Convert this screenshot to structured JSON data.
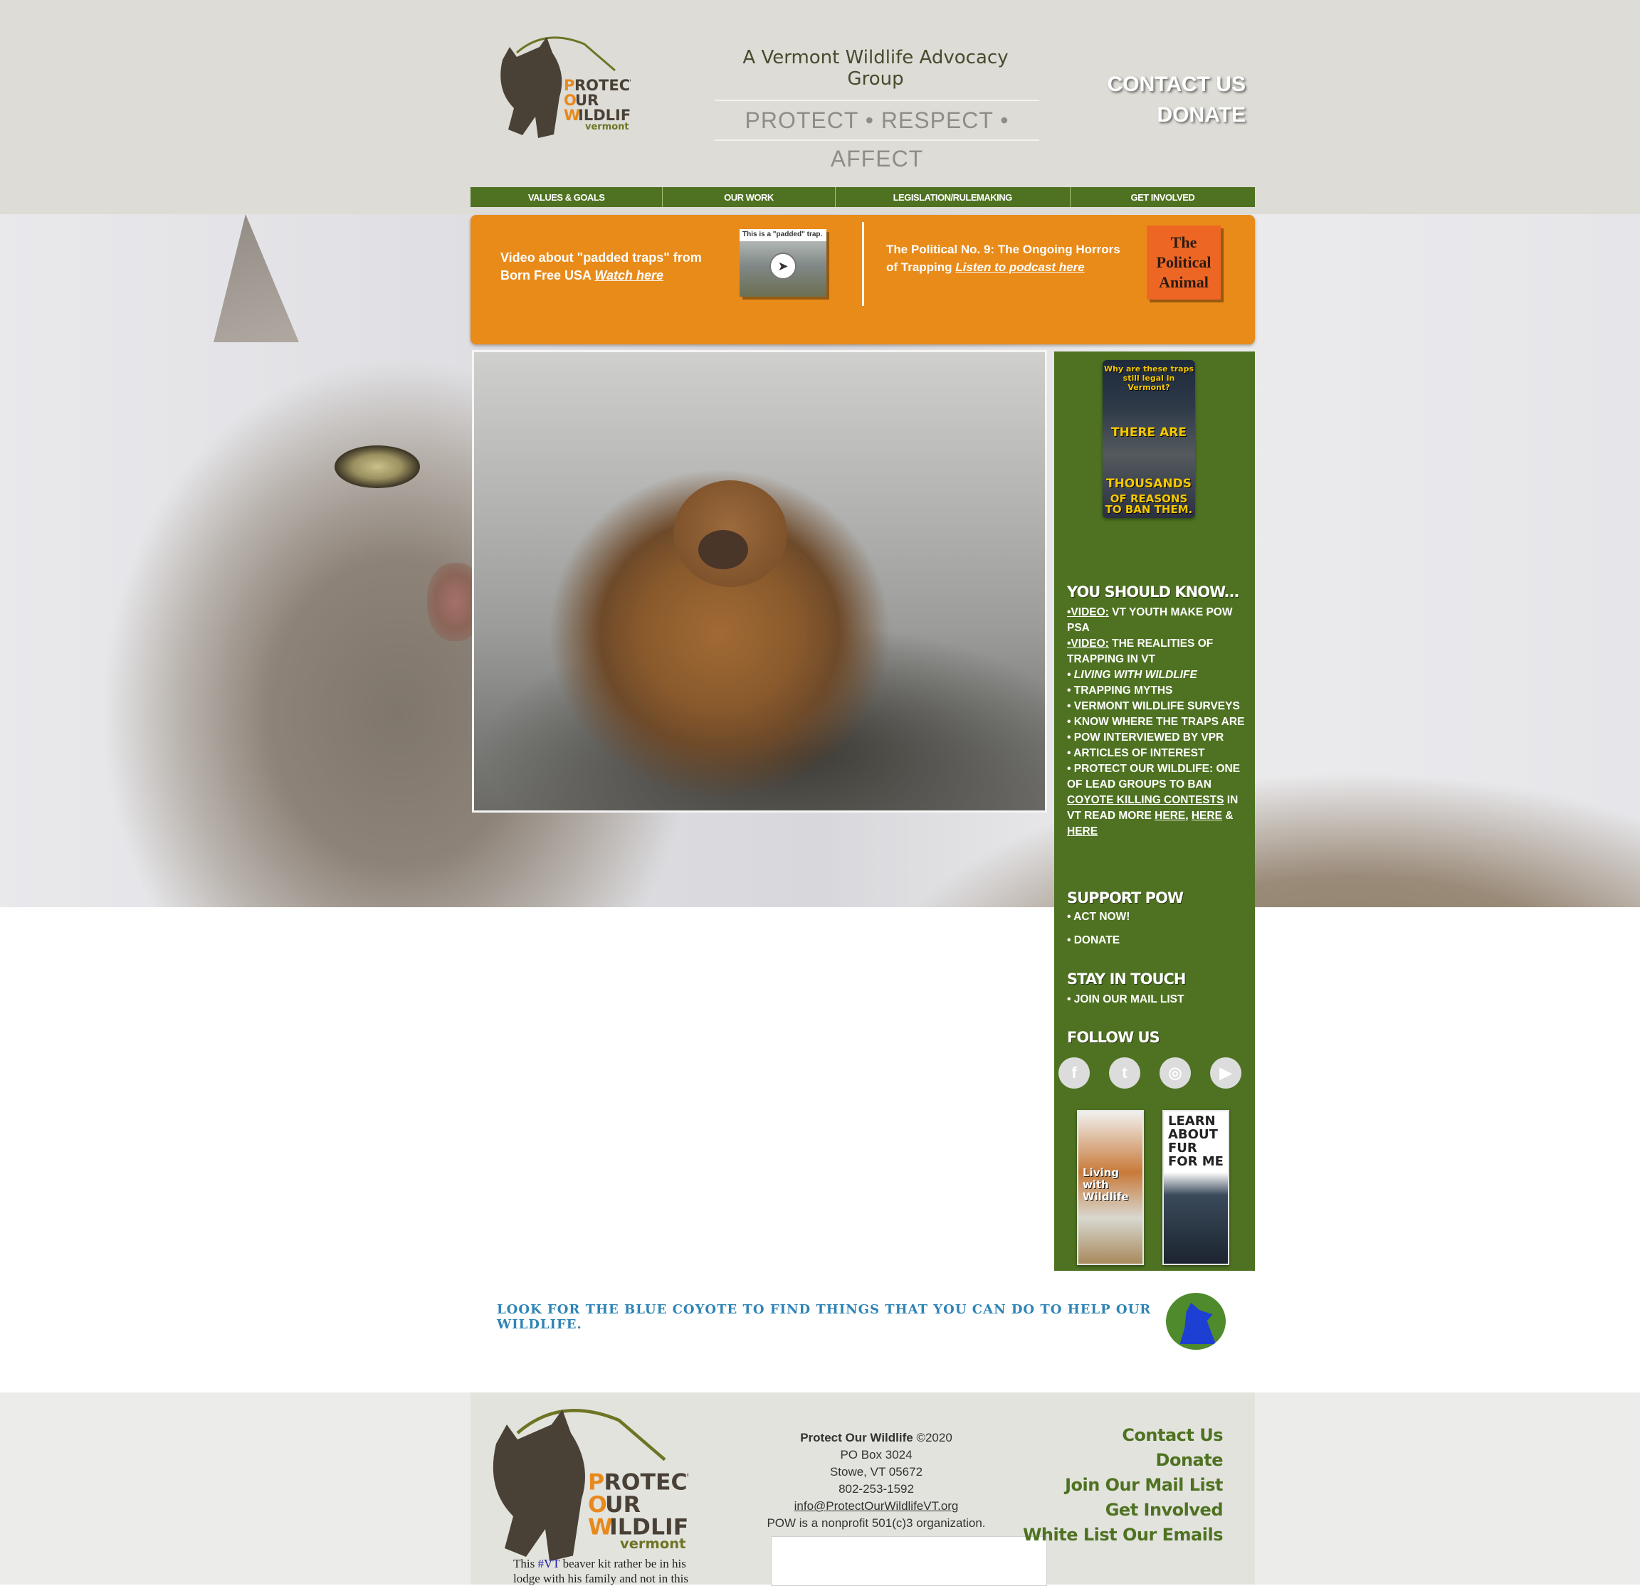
{
  "header": {
    "tagline": "A Vermont Wildlife Advocacy Group",
    "motto": "PROTECT • RESPECT • AFFECT",
    "contact_label": "CONTACT US",
    "donate_label": "DONATE",
    "logo": {
      "word1_initial": "P",
      "word1_rest": "ROTECT",
      "word2_initial": "O",
      "word2_rest": "UR",
      "word3_initial": "W",
      "word3_rest": "ILDLIFE",
      "state": "vermont"
    }
  },
  "nav": {
    "items": [
      {
        "label": "VALUES & GOALS"
      },
      {
        "label": "OUR WORK"
      },
      {
        "label": "LEGISLATION/RULEMAKING"
      },
      {
        "label": "GET INVOLVED"
      }
    ]
  },
  "banner": {
    "left_text": "Video about \"padded traps\" from Born Free USA",
    "left_link": "Watch here",
    "video_caption": "This is a \"padded\" trap.",
    "right_text": "The Political No. 9: The Ongoing Horrors of Trapping",
    "right_link": "Listen to podcast here",
    "podcast_title": "The Political Animal"
  },
  "sidebar": {
    "poster": {
      "line1": "Why are these traps still legal in Vermont?",
      "line2": "THERE ARE",
      "line3": "THOUSANDS",
      "line4": "OF REASONS TO BAN THEM."
    },
    "you_should_know": {
      "heading": "YOU SHOULD KNOW...",
      "items": [
        {
          "prefix": "•VIDEO:",
          "text": " VT YOUTH MAKE POW PSA"
        },
        {
          "prefix": "•VIDEO:",
          "text": " THE REALITIES OF TRAPPING IN VT"
        },
        {
          "prefix": "",
          "text": "• LIVING WITH WILDLIFE"
        },
        {
          "prefix": "",
          "text": "• TRAPPING MYTHS"
        },
        {
          "prefix": "",
          "text": "• VERMONT WILDLIFE SURVEYS"
        },
        {
          "prefix": "",
          "text": "• KNOW WHERE THE TRAPS ARE"
        },
        {
          "prefix": "",
          "text": "• POW INTERVIEWED BY VPR"
        },
        {
          "prefix": "",
          "text": "• ARTICLES OF INTEREST"
        }
      ],
      "lead_text": "• PROTECT OUR WILDLIFE: ONE OF LEAD GROUPS TO BAN",
      "lead_link": "COYOTE  KILLING CONTESTS",
      "lead_tail": "IN VT READ MORE",
      "here1": "HERE",
      "here2": "HERE",
      "amp": "&",
      "here3": "HERE"
    },
    "support": {
      "heading": "SUPPORT POW",
      "act": "• ACT NOW!",
      "donate": "• DONATE"
    },
    "stay": {
      "heading": "STAY IN TOUCH",
      "join": "• JOIN OUR MAIL LIST"
    },
    "follow": {
      "heading": "FOLLOW US",
      "icons": [
        "f",
        "t",
        "◎",
        "▶"
      ]
    },
    "booklets": {
      "fox": "Living with Wildlife",
      "fur": "LEARN ABOUT FUR FOR ME"
    }
  },
  "coyote": {
    "text": "Look for the blue coyote to find things that you can do to help our wildlife."
  },
  "footer": {
    "org": "Protect Our Wildlife",
    "copyright": " ©2020",
    "po_box": "PO Box 3024",
    "city": "Stowe, VT 05672",
    "phone": "802-253-1592",
    "email": "info@ProtectOurWildlifeVT.org",
    "nonprofit": "POW is a nonprofit 501(c)3 organization.",
    "caption_before": "This ",
    "caption_link": "#VT",
    "caption_after": " beaver kit rather be in his lodge with his family and not in this",
    "links": [
      "Contact Us",
      "Donate",
      "Join Our Mail List",
      "Get Involved",
      "White List Our Emails"
    ]
  },
  "colors": {
    "brand_green": "#4e7221",
    "banner_orange": "#e98b19",
    "logo_orange": "#e8891c",
    "coyote_blue": "#1d3fd4",
    "header_bg": "#dddcd6"
  }
}
